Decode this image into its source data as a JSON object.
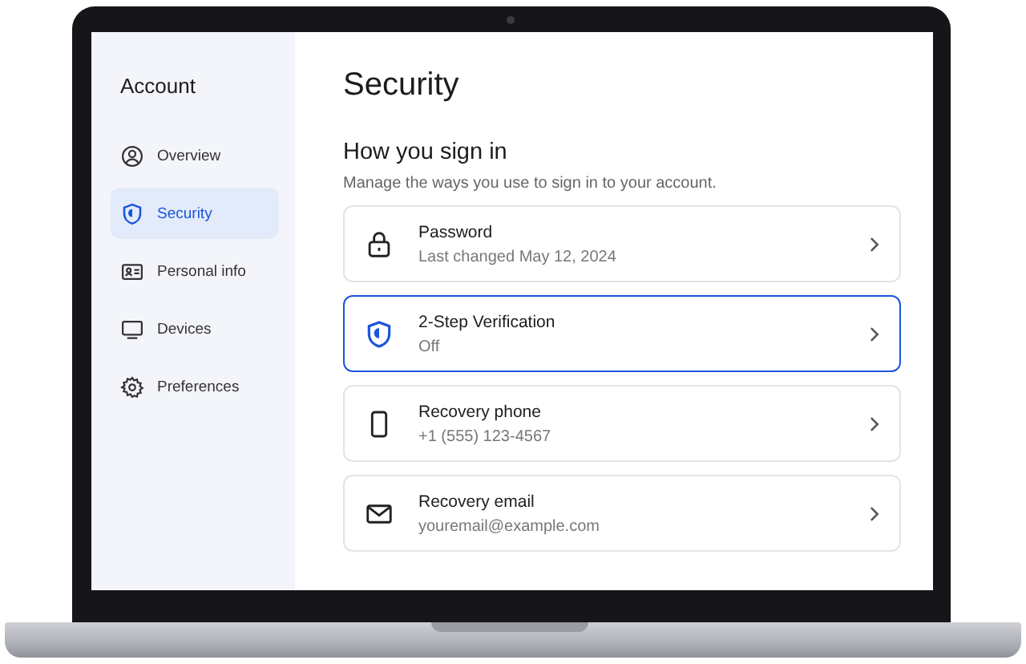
{
  "sidebar": {
    "title": "Account",
    "items": [
      {
        "kind": "overview",
        "label": "Overview",
        "selected": false
      },
      {
        "kind": "security",
        "label": "Security",
        "selected": true
      },
      {
        "kind": "personal",
        "label": "Personal info",
        "selected": false
      },
      {
        "kind": "devices",
        "label": "Devices",
        "selected": false
      },
      {
        "kind": "preferences",
        "label": "Preferences",
        "selected": false
      }
    ]
  },
  "page": {
    "title": "Security",
    "section": {
      "heading": "How you sign in",
      "description": "Manage the ways you use to sign in to your account.",
      "items": [
        {
          "kind": "password",
          "title": "Password",
          "subtitle": "Last changed May 12, 2024",
          "selected": false
        },
        {
          "kind": "two_step",
          "title": "2-Step Verification",
          "subtitle": "Off",
          "selected": true
        },
        {
          "kind": "phone",
          "title": "Recovery phone",
          "subtitle": "+1 (555) 123-4567",
          "selected": false
        },
        {
          "kind": "email",
          "title": "Recovery email",
          "subtitle": "youremail@example.com",
          "selected": false
        }
      ]
    }
  }
}
